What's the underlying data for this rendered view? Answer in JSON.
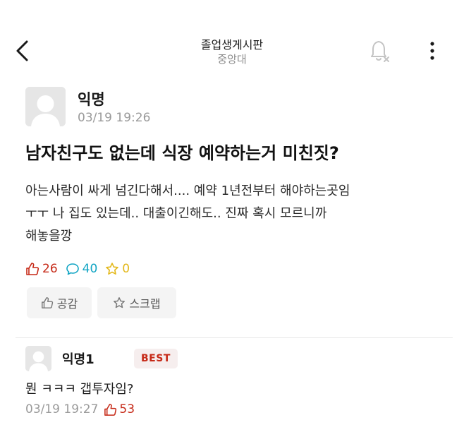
{
  "header": {
    "title": "졸업생게시판",
    "subtitle": "중앙대"
  },
  "post": {
    "author": "익명",
    "time": "03/19 19:26",
    "title": "남자친구도 없는데 식장 예약하는거 미친짓?",
    "body_lines": [
      "아는사람이 싸게 넘긴다해서.... 예약 1년전부터 해야하는곳임",
      "ㅜㅜ 나 집도 있는데.. 대출이긴해도.. 진짜 혹시 모르니까",
      "해놓을깡"
    ],
    "stats": {
      "likes": "26",
      "comments": "40",
      "scraps": "0"
    },
    "actions": {
      "like_label": "공감",
      "scrap_label": "스크랩"
    }
  },
  "comment": {
    "author": "익명1",
    "badge": "BEST",
    "body": "뭔 ㅋㅋㅋ 갭투자임?",
    "time": "03/19 19:27",
    "likes": "53"
  },
  "colors": {
    "like": "#c62917",
    "comment": "#12a5c4",
    "scrap": "#e3b81b",
    "muted": "#9a9a9a"
  },
  "icons": [
    "back-arrow-icon",
    "bell-off-icon",
    "more-vertical-icon",
    "thumbs-up-icon",
    "speech-bubble-icon",
    "star-icon"
  ]
}
